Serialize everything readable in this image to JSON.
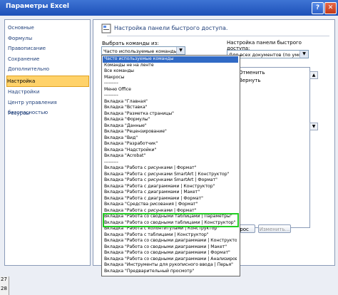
{
  "window": {
    "title": "Параметры Excel",
    "help_label": "?",
    "close_label": "✕"
  },
  "nav": {
    "items": [
      "Основные",
      "Формулы",
      "Правописание",
      "Сохранение",
      "Дополнительно",
      "Настройка",
      "Надстройки",
      "Центр управления безопасностью",
      "Ресурсы"
    ],
    "selected": "Настройка"
  },
  "header": {
    "text": "Настройка панели быстрого доступа.",
    "icon": "qat-icon"
  },
  "choose": {
    "label": "Выбрать команды из:",
    "value": "Часто используемые команды"
  },
  "qat": {
    "label": "Настройка панели быстрого доступа:",
    "value": "Для всех документов (по умолч..."
  },
  "right_list": {
    "items": [
      "Отменить",
      "Вернуть"
    ]
  },
  "buttons": {
    "reset": "Сброс",
    "modify": "Изменить..."
  },
  "dropdown": {
    "items": [
      "Часто используемые команды",
      "Команды не на ленте",
      "Все команды",
      "Макросы",
      "---------",
      "Меню Office",
      "---------",
      "Вкладка \"Главная\"",
      "Вкладка \"Вставка\"",
      "Вкладка \"Разметка страницы\"",
      "Вкладка \"Формулы\"",
      "Вкладка \"Данные\"",
      "Вкладка \"Рецензирование\"",
      "Вкладка \"Вид\"",
      "Вкладка \"Разработчик\"",
      "Вкладка \"Надстройки\"",
      "Вкладка \"Acrobat\"",
      "---------",
      "Вкладка \"Работа с рисунками | Формат\"",
      "Вкладка \"Работа с рисунками SmartArt | Конструктор\"",
      "Вкладка \"Работа с рисунками SmartArt | Формат\"",
      "Вкладка \"Работа с диаграммами | Конструктор\"",
      "Вкладка \"Работа с диаграммами | Макет\"",
      "Вкладка \"Работа с диаграммами | Формат\"",
      "Вкладка \"Средства рисования | Формат\"",
      "Вкладка \"Работа с рисунками | Формат\"",
      "Вкладка \"Работа со сводными таблицами | Параметры\"",
      "Вкладка \"Работа со сводными таблицами | Конструктор\"",
      "Вкладка \"Работа с колонтитулами | Конструктор\"",
      "Вкладка \"Работа с таблицами | Конструктор\"",
      "Вкладка \"Работа со сводными диаграммами | Конструктор\"",
      "Вкладка \"Работа со сводными диаграммами | Макет\"",
      "Вкладка \"Работа со сводными диаграммами | Формат\"",
      "Вкладка \"Работа со сводными диаграммами | Анализировать\"",
      "Вкладка \"Инструменты для рукописного ввода | Перья\"",
      "Вкладка \"Предварительный просмотр\""
    ],
    "highlighted_index": 0
  },
  "sheet": {
    "rows": [
      "27",
      "28"
    ]
  },
  "colors": {
    "title_bar": "#1c50b8",
    "highlight": "#316ac5",
    "nav_selected": "#ffd26a",
    "green_box": "#22cc22"
  }
}
